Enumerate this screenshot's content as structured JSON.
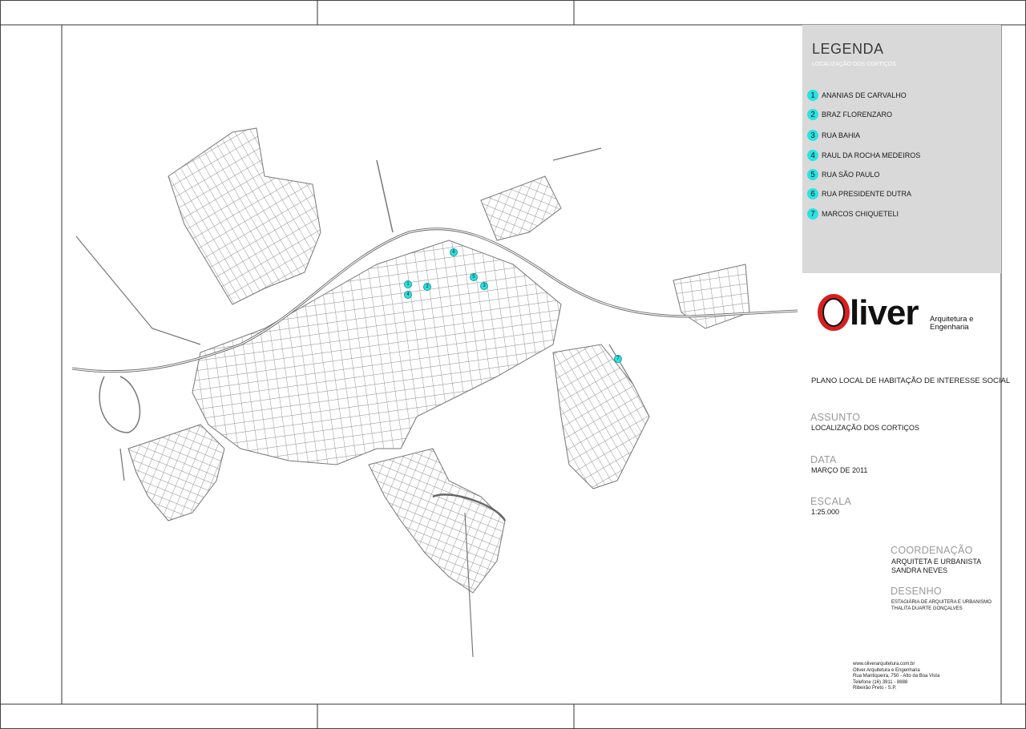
{
  "legend": {
    "title": "LEGENDA",
    "subtitle": "LOCALIZAÇÃO DOS CORTIÇOS",
    "items": [
      {
        "num": "1",
        "label": "ANANIAS DE CARVALHO"
      },
      {
        "num": "2",
        "label": "BRAZ FLORENZARO"
      },
      {
        "num": "3",
        "label": "RUA BAHIA"
      },
      {
        "num": "4",
        "label": "RAUL DA ROCHA MEDEIROS"
      },
      {
        "num": "5",
        "label": "RUA SÃO PAULO"
      },
      {
        "num": "6",
        "label": "RUA PRESIDENTE DUTRA"
      },
      {
        "num": "7",
        "label": "MARCOS CHIQUETELI"
      }
    ],
    "marker_color": "#29e3e3"
  },
  "logo": {
    "name": "Oliver",
    "tagline_1": "Arquitetura e",
    "tagline_2": "Engenharia",
    "accent": "#d81e1e"
  },
  "project": {
    "title": "PLANO LOCAL DE HABITAÇÃO DE INTERESSE SOCIAL",
    "subject_head": "ASSUNTO",
    "subject": "LOCALIZAÇÃO DOS CORTIÇOS",
    "date_head": "DATA",
    "date": "MARÇO DE 2011",
    "scale_head": "ESCALA",
    "scale": "1:25.000",
    "coord_head": "COORDENAÇÃO",
    "coord_1": "ARQUITETA E URBANISTA",
    "coord_2": "SANDRA NEVES",
    "design_head": "DESENHO",
    "design_1": "ESTAGIÁRIA DE ARQUITERA E URBANISMO",
    "design_2": "THALITA DUARTE GONÇALVES"
  },
  "contact": {
    "line_1": "www.oliverarquitetura.com.br",
    "line_2": "Oliver Arquitetura e Engenharia",
    "line_3": "Rua Mantiqueira, 750 - Alto da Boa Vista",
    "line_4": "Telefone (16) 3911 - 8888",
    "line_5": "Ribeirão Preto - S.P."
  },
  "map_markers": [
    {
      "num": "1"
    },
    {
      "num": "2"
    },
    {
      "num": "3"
    },
    {
      "num": "4"
    },
    {
      "num": "5"
    },
    {
      "num": "6"
    },
    {
      "num": "7"
    }
  ]
}
